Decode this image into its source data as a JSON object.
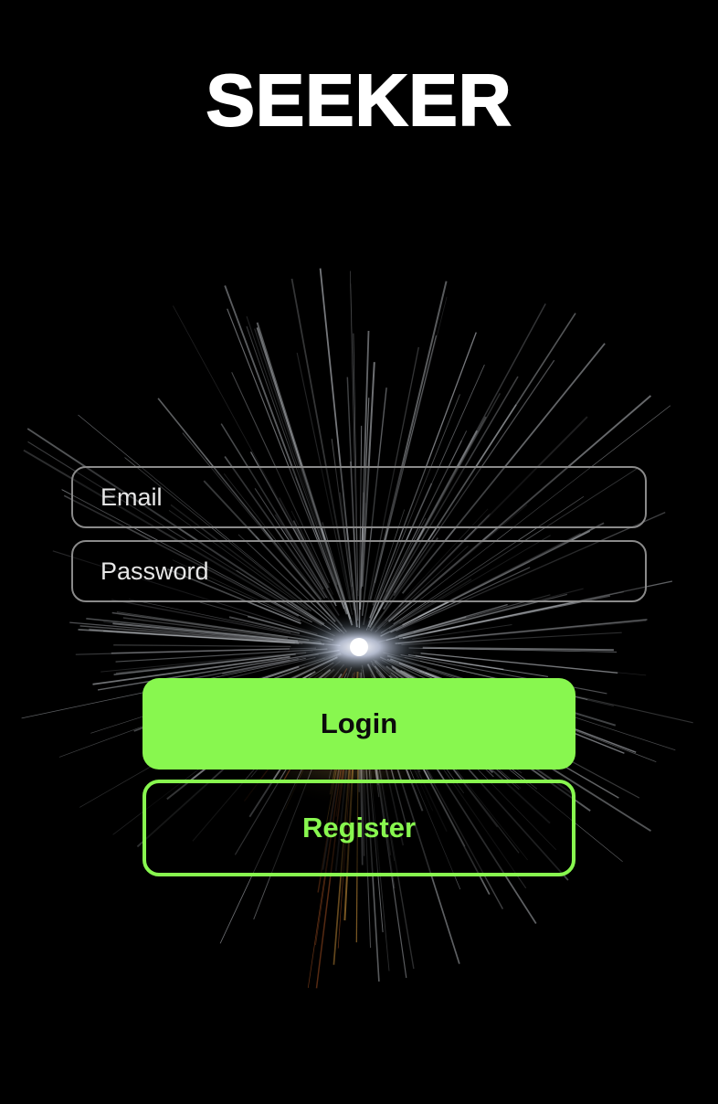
{
  "app": {
    "title": "SEEKER"
  },
  "form": {
    "email_placeholder": "Email",
    "email_value": "",
    "password_placeholder": "Password",
    "password_value": ""
  },
  "actions": {
    "login_label": "Login",
    "register_label": "Register"
  },
  "colors": {
    "background": "#000000",
    "accent": "#88f74f",
    "field_border": "#8a8a8a",
    "text": "#ffffff"
  },
  "icons": {
    "background_art": "starburst-light-art"
  }
}
